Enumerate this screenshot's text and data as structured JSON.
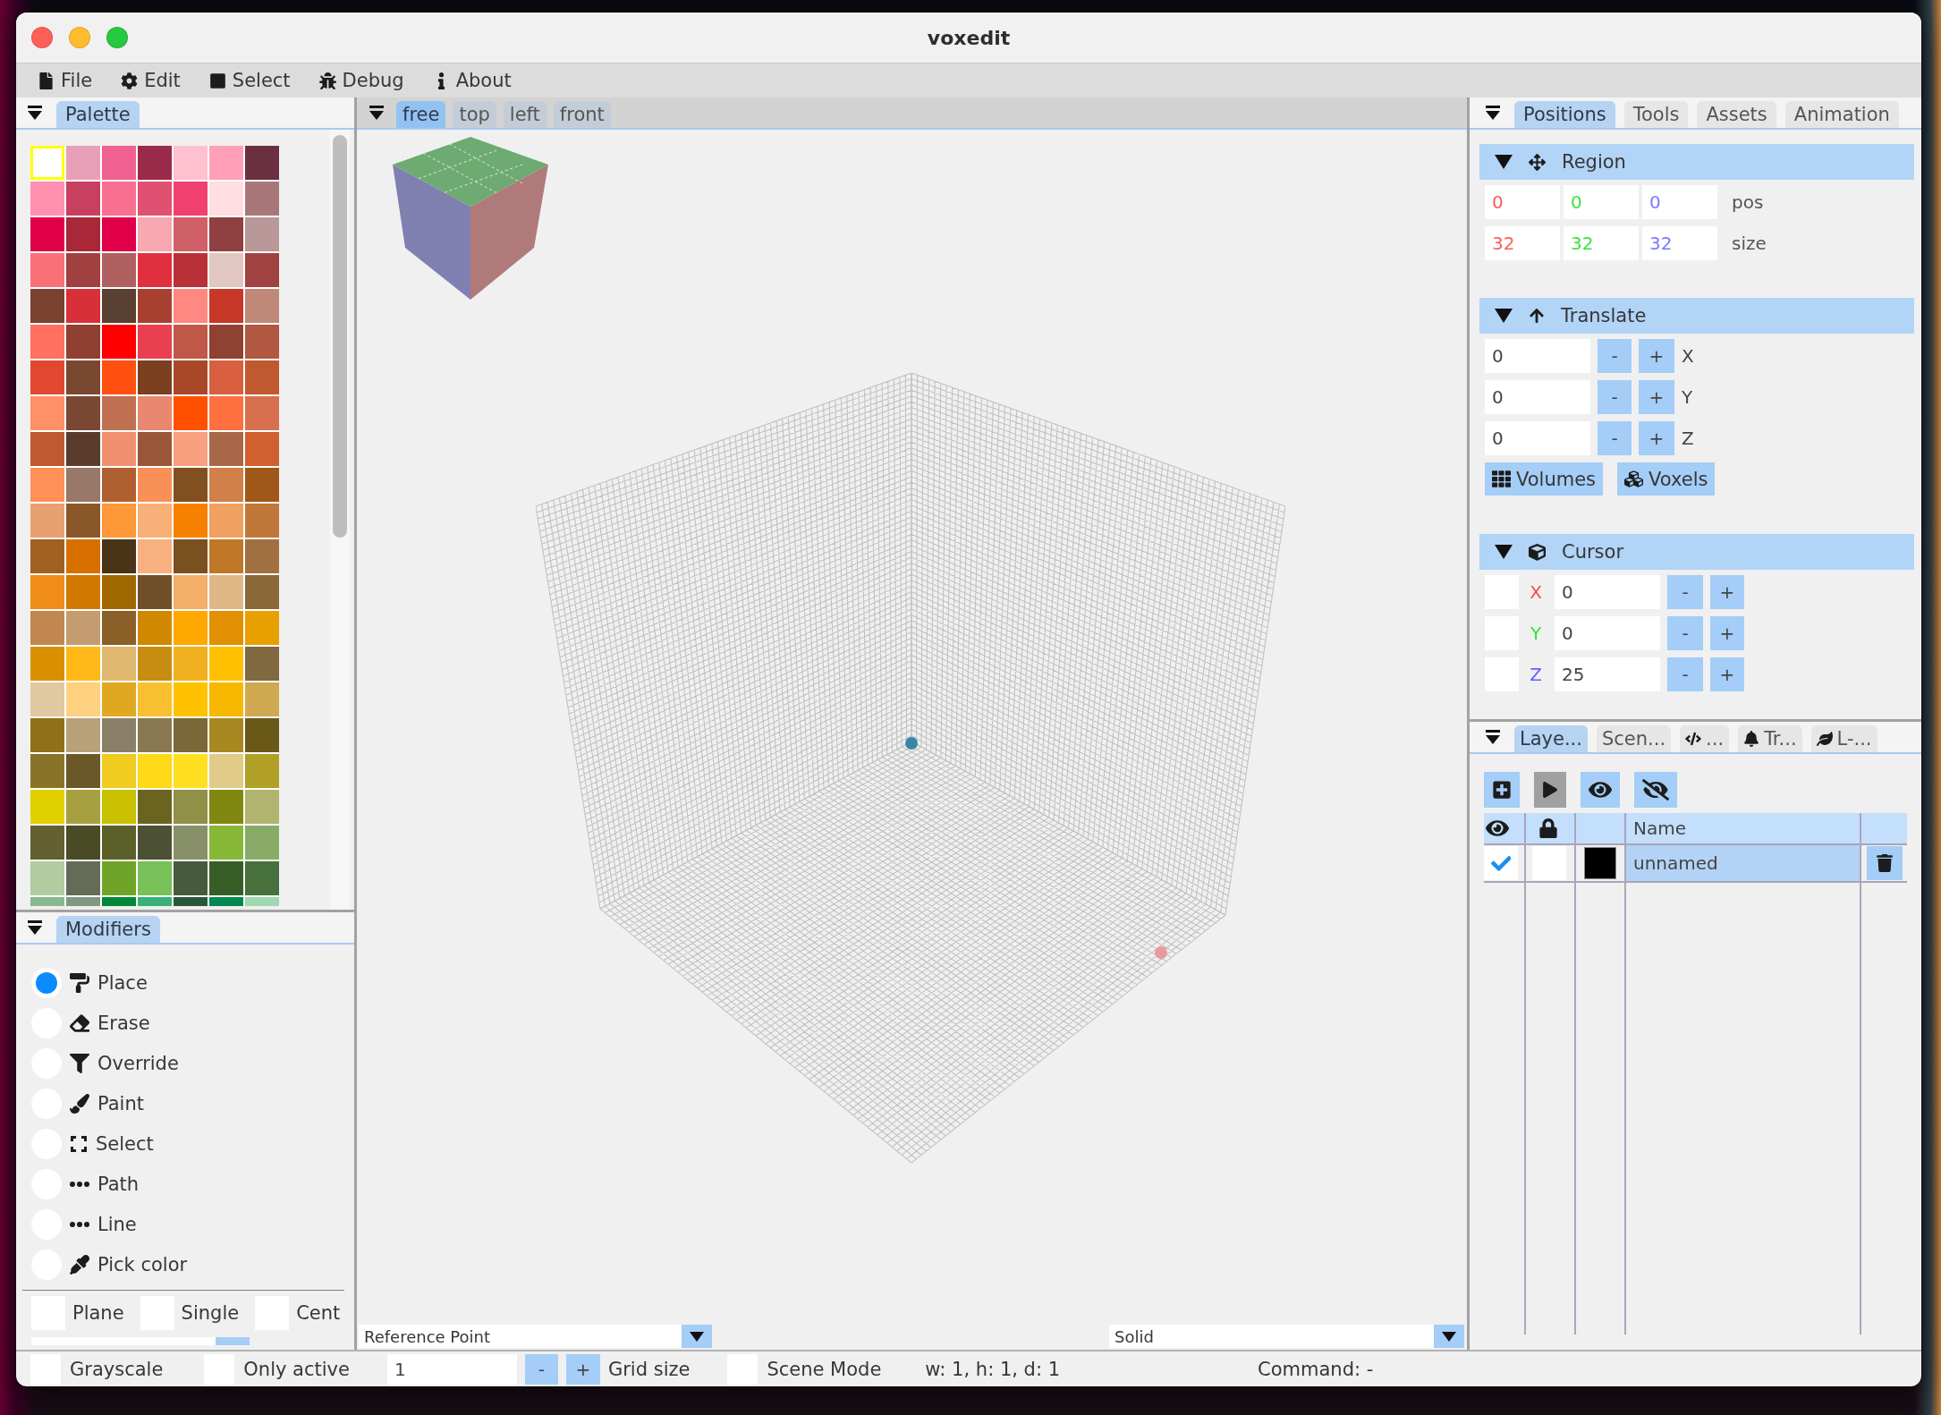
{
  "window": {
    "title": "voxedit"
  },
  "menu_bar": {
    "items": [
      "File",
      "Edit",
      "Select",
      "Debug",
      "About"
    ]
  },
  "palette_panel": {
    "tabs": [
      {
        "label": "Palette",
        "selected": true
      }
    ],
    "swatches": [
      {
        "color": "#ffffff",
        "selected": true
      },
      {
        "color": "#e8a0b8",
        "selected": false
      },
      {
        "color": "#f06090",
        "selected": false
      },
      {
        "color": "#9a2a4a",
        "selected": false
      },
      {
        "color": "#ffc0d0",
        "selected": false
      },
      {
        "color": "#ffa0b8",
        "selected": false
      },
      {
        "color": "#6a3040",
        "selected": false
      },
      {
        "color": "#ff90b0",
        "selected": false
      },
      {
        "color": "#c84060",
        "selected": false
      },
      {
        "color": "#f87090",
        "selected": false
      },
      {
        "color": "#e05070",
        "selected": false
      },
      {
        "color": "#f04070",
        "selected": false
      },
      {
        "color": "#ffdde0",
        "selected": false
      },
      {
        "color": "#a87878",
        "selected": false
      },
      {
        "color": "#e00048",
        "selected": false
      },
      {
        "color": "#a82838",
        "selected": false
      },
      {
        "color": "#e0004a",
        "selected": false
      },
      {
        "color": "#f8a8b0",
        "selected": false
      },
      {
        "color": "#d06068",
        "selected": false
      },
      {
        "color": "#904040",
        "selected": false
      },
      {
        "color": "#b89898",
        "selected": false
      },
      {
        "color": "#f87078",
        "selected": false
      },
      {
        "color": "#a04040",
        "selected": false
      },
      {
        "color": "#b06060",
        "selected": false
      },
      {
        "color": "#e03040",
        "selected": false
      },
      {
        "color": "#b83038",
        "selected": false
      },
      {
        "color": "#e0c8c0",
        "selected": false
      },
      {
        "color": "#a04242",
        "selected": false
      },
      {
        "color": "#7a4030",
        "selected": false
      },
      {
        "color": "#d83038",
        "selected": false
      },
      {
        "color": "#5a4030",
        "selected": false
      },
      {
        "color": "#a84030",
        "selected": false
      },
      {
        "color": "#ff8880",
        "selected": false
      },
      {
        "color": "#c83828",
        "selected": false
      },
      {
        "color": "#c08878",
        "selected": false
      },
      {
        "color": "#ff7060",
        "selected": false
      },
      {
        "color": "#904030",
        "selected": false
      },
      {
        "color": "#ff0000",
        "selected": false
      },
      {
        "color": "#e84050",
        "selected": false
      },
      {
        "color": "#c05848",
        "selected": false
      },
      {
        "color": "#904232",
        "selected": false
      },
      {
        "color": "#b05840",
        "selected": false
      },
      {
        "color": "#e04830",
        "selected": false
      },
      {
        "color": "#7a4830",
        "selected": false
      },
      {
        "color": "#ff5010",
        "selected": false
      },
      {
        "color": "#7a4020",
        "selected": false
      },
      {
        "color": "#a84828",
        "selected": false
      },
      {
        "color": "#d86040",
        "selected": false
      },
      {
        "color": "#c05830",
        "selected": false
      },
      {
        "color": "#ff9068",
        "selected": false
      },
      {
        "color": "#7a4832",
        "selected": false
      },
      {
        "color": "#c07050",
        "selected": false
      },
      {
        "color": "#e88870",
        "selected": false
      },
      {
        "color": "#ff5000",
        "selected": false
      },
      {
        "color": "#ff7040",
        "selected": false
      },
      {
        "color": "#d87050",
        "selected": false
      },
      {
        "color": "#c05832",
        "selected": false
      },
      {
        "color": "#5a3c2c",
        "selected": false
      },
      {
        "color": "#f09070",
        "selected": false
      },
      {
        "color": "#985838",
        "selected": false
      },
      {
        "color": "#f8a080",
        "selected": false
      },
      {
        "color": "#a86848",
        "selected": false
      },
      {
        "color": "#d06030",
        "selected": false
      },
      {
        "color": "#ff9058",
        "selected": false
      },
      {
        "color": "#987868",
        "selected": false
      },
      {
        "color": "#b06030",
        "selected": false
      },
      {
        "color": "#f89058",
        "selected": false
      },
      {
        "color": "#805020",
        "selected": false
      },
      {
        "color": "#d08048",
        "selected": false
      },
      {
        "color": "#a05818",
        "selected": false
      },
      {
        "color": "#e8a070",
        "selected": false
      },
      {
        "color": "#8a5828",
        "selected": false
      },
      {
        "color": "#ff9838",
        "selected": false
      },
      {
        "color": "#f8b078",
        "selected": false
      },
      {
        "color": "#f88000",
        "selected": false
      },
      {
        "color": "#f0a060",
        "selected": false
      },
      {
        "color": "#c07838",
        "selected": false
      },
      {
        "color": "#a06020",
        "selected": false
      },
      {
        "color": "#d87000",
        "selected": false
      },
      {
        "color": "#4a3418",
        "selected": false
      },
      {
        "color": "#f8b080",
        "selected": false
      },
      {
        "color": "#7a5020",
        "selected": false
      },
      {
        "color": "#c07828",
        "selected": false
      },
      {
        "color": "#a07040",
        "selected": false
      },
      {
        "color": "#f08c18",
        "selected": false
      },
      {
        "color": "#d07800",
        "selected": false
      },
      {
        "color": "#a06800",
        "selected": false
      },
      {
        "color": "#705028",
        "selected": false
      },
      {
        "color": "#f4b068",
        "selected": false
      },
      {
        "color": "#e0b888",
        "selected": false
      },
      {
        "color": "#8a6838",
        "selected": false
      },
      {
        "color": "#c08850",
        "selected": false
      },
      {
        "color": "#c49c70",
        "selected": false
      },
      {
        "color": "#8a6028",
        "selected": false
      },
      {
        "color": "#d08800",
        "selected": false
      },
      {
        "color": "#ffa800",
        "selected": false
      },
      {
        "color": "#e09000",
        "selected": false
      },
      {
        "color": "#e8a000",
        "selected": false
      },
      {
        "color": "#d89000",
        "selected": false
      },
      {
        "color": "#ffb818",
        "selected": false
      },
      {
        "color": "#e0b870",
        "selected": false
      },
      {
        "color": "#c88c10",
        "selected": false
      },
      {
        "color": "#f0b020",
        "selected": false
      },
      {
        "color": "#ffc000",
        "selected": false
      },
      {
        "color": "#806840",
        "selected": false
      },
      {
        "color": "#e0c8a0",
        "selected": false
      },
      {
        "color": "#ffd080",
        "selected": false
      },
      {
        "color": "#e0a820",
        "selected": false
      },
      {
        "color": "#f8c030",
        "selected": false
      },
      {
        "color": "#ffc200",
        "selected": false
      },
      {
        "color": "#f8b800",
        "selected": false
      },
      {
        "color": "#d0a850",
        "selected": false
      },
      {
        "color": "#907018",
        "selected": false
      },
      {
        "color": "#b8a078",
        "selected": false
      },
      {
        "color": "#8a8068",
        "selected": false
      },
      {
        "color": "#8a7850",
        "selected": false
      },
      {
        "color": "#7a6838",
        "selected": false
      },
      {
        "color": "#a88820",
        "selected": false
      },
      {
        "color": "#6a5818",
        "selected": false
      },
      {
        "color": "#887428",
        "selected": false
      },
      {
        "color": "#6a5828",
        "selected": false
      },
      {
        "color": "#f0cc20",
        "selected": false
      },
      {
        "color": "#ffd818",
        "selected": false
      },
      {
        "color": "#ffe020",
        "selected": false
      },
      {
        "color": "#e0cc88",
        "selected": false
      },
      {
        "color": "#b0a028",
        "selected": false
      },
      {
        "color": "#e0d000",
        "selected": false
      },
      {
        "color": "#a8a040",
        "selected": false
      },
      {
        "color": "#c8c000",
        "selected": false
      },
      {
        "color": "#6a6420",
        "selected": false
      },
      {
        "color": "#909048",
        "selected": false
      },
      {
        "color": "#808810",
        "selected": false
      },
      {
        "color": "#b0b470",
        "selected": false
      },
      {
        "color": "#646030",
        "selected": false
      },
      {
        "color": "#4a4c28",
        "selected": false
      },
      {
        "color": "#5a6028",
        "selected": false
      },
      {
        "color": "#4c5034",
        "selected": false
      },
      {
        "color": "#88906a",
        "selected": false
      },
      {
        "color": "#88b838",
        "selected": false
      },
      {
        "color": "#88ac68",
        "selected": false
      },
      {
        "color": "#b0cca0",
        "selected": false
      },
      {
        "color": "#646c58",
        "selected": false
      },
      {
        "color": "#70a428",
        "selected": false
      },
      {
        "color": "#78c058",
        "selected": false
      },
      {
        "color": "#465a3c",
        "selected": false
      },
      {
        "color": "#385e28",
        "selected": false
      },
      {
        "color": "#48703c",
        "selected": false
      },
      {
        "color": "#88b890",
        "selected": false
      },
      {
        "color": "#809880",
        "selected": false
      },
      {
        "color": "#008838",
        "selected": false
      },
      {
        "color": "#38b078",
        "selected": false
      },
      {
        "color": "#285838",
        "selected": false
      },
      {
        "color": "#008850",
        "selected": false
      },
      {
        "color": "#a0d8b0",
        "selected": false
      }
    ]
  },
  "modifiers_panel": {
    "tabs": [
      {
        "label": "Modifiers",
        "selected": true
      }
    ],
    "modes": [
      {
        "label": "Place",
        "selected": true
      },
      {
        "label": "Erase",
        "selected": false
      },
      {
        "label": "Override",
        "selected": false
      },
      {
        "label": "Paint",
        "selected": false
      },
      {
        "label": "Select",
        "selected": false
      },
      {
        "label": "Path",
        "selected": false
      },
      {
        "label": "Line",
        "selected": false
      },
      {
        "label": "Pick color",
        "selected": false
      }
    ],
    "options": [
      {
        "label": "Plane",
        "checked": false
      },
      {
        "label": "Single",
        "checked": false
      },
      {
        "label": "Cent",
        "checked": false
      }
    ]
  },
  "viewport": {
    "tabs": [
      {
        "label": "free",
        "selected": true
      },
      {
        "label": "top",
        "selected": false
      },
      {
        "label": "left",
        "selected": false
      },
      {
        "label": "front",
        "selected": false
      }
    ],
    "reference_dropdown": {
      "value": "Reference Point"
    },
    "render_dropdown": {
      "value": "Solid"
    }
  },
  "positions_panel": {
    "tabs": [
      {
        "label": "Positions",
        "selected": true
      },
      {
        "label": "Tools",
        "selected": false
      },
      {
        "label": "Assets",
        "selected": false
      },
      {
        "label": "Animation",
        "selected": false
      }
    ],
    "region": {
      "title": "Region",
      "expanded": true,
      "rows": [
        {
          "label": "pos",
          "values": [
            {
              "value": "0",
              "color": "#ff5a5a"
            },
            {
              "value": "0",
              "color": "#3ee03e"
            },
            {
              "value": "0",
              "color": "#7a7aff"
            }
          ]
        },
        {
          "label": "size",
          "values": [
            {
              "value": "32",
              "color": "#ff5a5a"
            },
            {
              "value": "32",
              "color": "#3ee03e"
            },
            {
              "value": "32",
              "color": "#7a7aff"
            }
          ]
        }
      ]
    },
    "translate": {
      "title": "Translate",
      "expanded": true,
      "rows": [
        {
          "value": "0",
          "minus": "-",
          "plus": "+",
          "axis": "X"
        },
        {
          "value": "0",
          "minus": "-",
          "plus": "+",
          "axis": "Y"
        },
        {
          "value": "0",
          "minus": "-",
          "plus": "+",
          "axis": "Z"
        }
      ],
      "buttons": [
        {
          "label": "Volumes"
        },
        {
          "label": "Voxels"
        }
      ]
    },
    "cursor": {
      "title": "Cursor",
      "expanded": true,
      "rows": [
        {
          "checked": false,
          "axis": "X",
          "color": "#ff4545",
          "value": "0",
          "minus": "-",
          "plus": "+"
        },
        {
          "checked": false,
          "axis": "Y",
          "color": "#30e030",
          "value": "0",
          "minus": "-",
          "plus": "+"
        },
        {
          "checked": false,
          "axis": "Z",
          "color": "#6060ff",
          "value": "25",
          "minus": "-",
          "plus": "+"
        }
      ]
    }
  },
  "layers_panel": {
    "tabs": [
      {
        "label": "Laye...",
        "selected": true
      },
      {
        "label": "Scen...",
        "selected": false
      },
      {
        "label": "...",
        "selected": false
      },
      {
        "label": "Tr...",
        "selected": false
      },
      {
        "label": "L-...",
        "selected": false
      }
    ],
    "toolbar": [
      {
        "disabled": false
      },
      {
        "disabled": true
      },
      {
        "disabled": false
      },
      {
        "disabled": false
      }
    ],
    "table": {
      "name_column": "Name",
      "rows": [
        {
          "visible": true,
          "locked": false,
          "color": "#000000",
          "name": "unnamed",
          "selected": true
        }
      ]
    }
  },
  "status_bar": {
    "grayscale": {
      "label": "Grayscale",
      "checked": false
    },
    "only_active": {
      "label": "Only active",
      "checked": false
    },
    "grid_size": {
      "value": "1",
      "minus": "-",
      "plus": "+",
      "label": "Grid size"
    },
    "scene_mode": {
      "label": "Scene Mode",
      "checked": false
    },
    "dimensions": "w: 1, h: 1, d: 1",
    "command": "Command: -"
  }
}
